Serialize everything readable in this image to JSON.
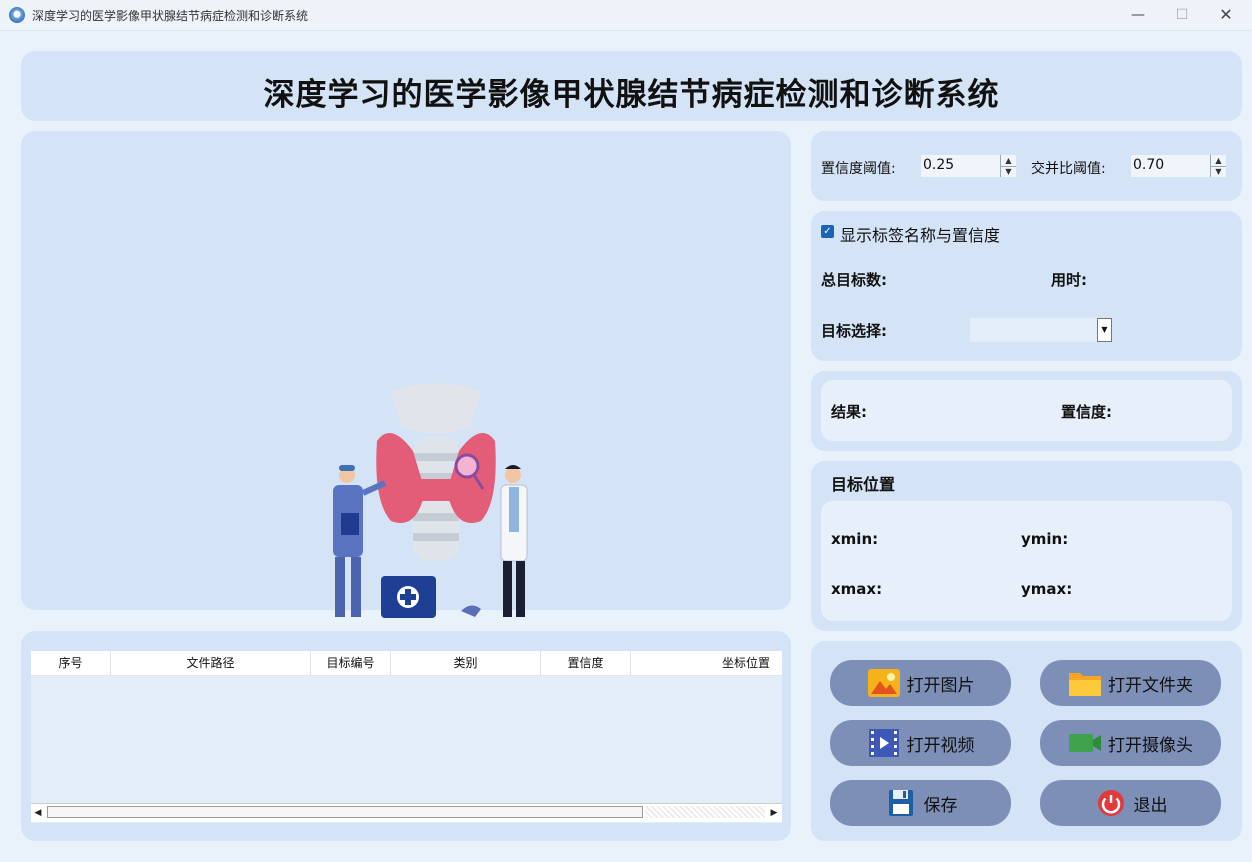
{
  "window": {
    "title": "深度学习的医学影像甲状腺结节病症检测和诊断系统",
    "minimize": "—",
    "maximize": "☐",
    "close": "✕"
  },
  "header": {
    "title": "深度学习的医学影像甲状腺结节病症检测和诊断系统"
  },
  "thresholds": {
    "confidence_label": "置信度阈值:",
    "confidence_value": "0.25",
    "iou_label": "交并比阈值:",
    "iou_value": "0.70"
  },
  "options": {
    "show_labels_text": "显示标签名称与置信度",
    "show_labels_checked": true,
    "total_targets_label": "总目标数:",
    "time_label": "用时:",
    "target_select_label": "目标选择:",
    "target_select_value": ""
  },
  "result": {
    "result_label": "结果:",
    "confidence_label": "置信度:"
  },
  "position": {
    "title": "目标位置",
    "xmin_label": "xmin:",
    "ymin_label": "ymin:",
    "xmax_label": "xmax:",
    "ymax_label": "ymax:"
  },
  "table": {
    "columns": [
      "序号",
      "文件路径",
      "目标编号",
      "类别",
      "置信度",
      "坐标位置"
    ]
  },
  "buttons": {
    "open_image": "打开图片",
    "open_folder": "打开文件夹",
    "open_video": "打开视频",
    "open_camera": "打开摄像头",
    "save": "保存",
    "exit": "退出"
  },
  "icons": {
    "app": "thyroid-app-icon",
    "image": "image-icon",
    "folder": "folder-icon",
    "video": "film-icon",
    "camera": "video-camera-icon",
    "save": "floppy-icon",
    "exit": "power-icon"
  },
  "colors": {
    "background": "#e9f1fb",
    "panel": "#d4e3f6",
    "button": "#7d8fb7",
    "accent": "#1a64b8"
  }
}
